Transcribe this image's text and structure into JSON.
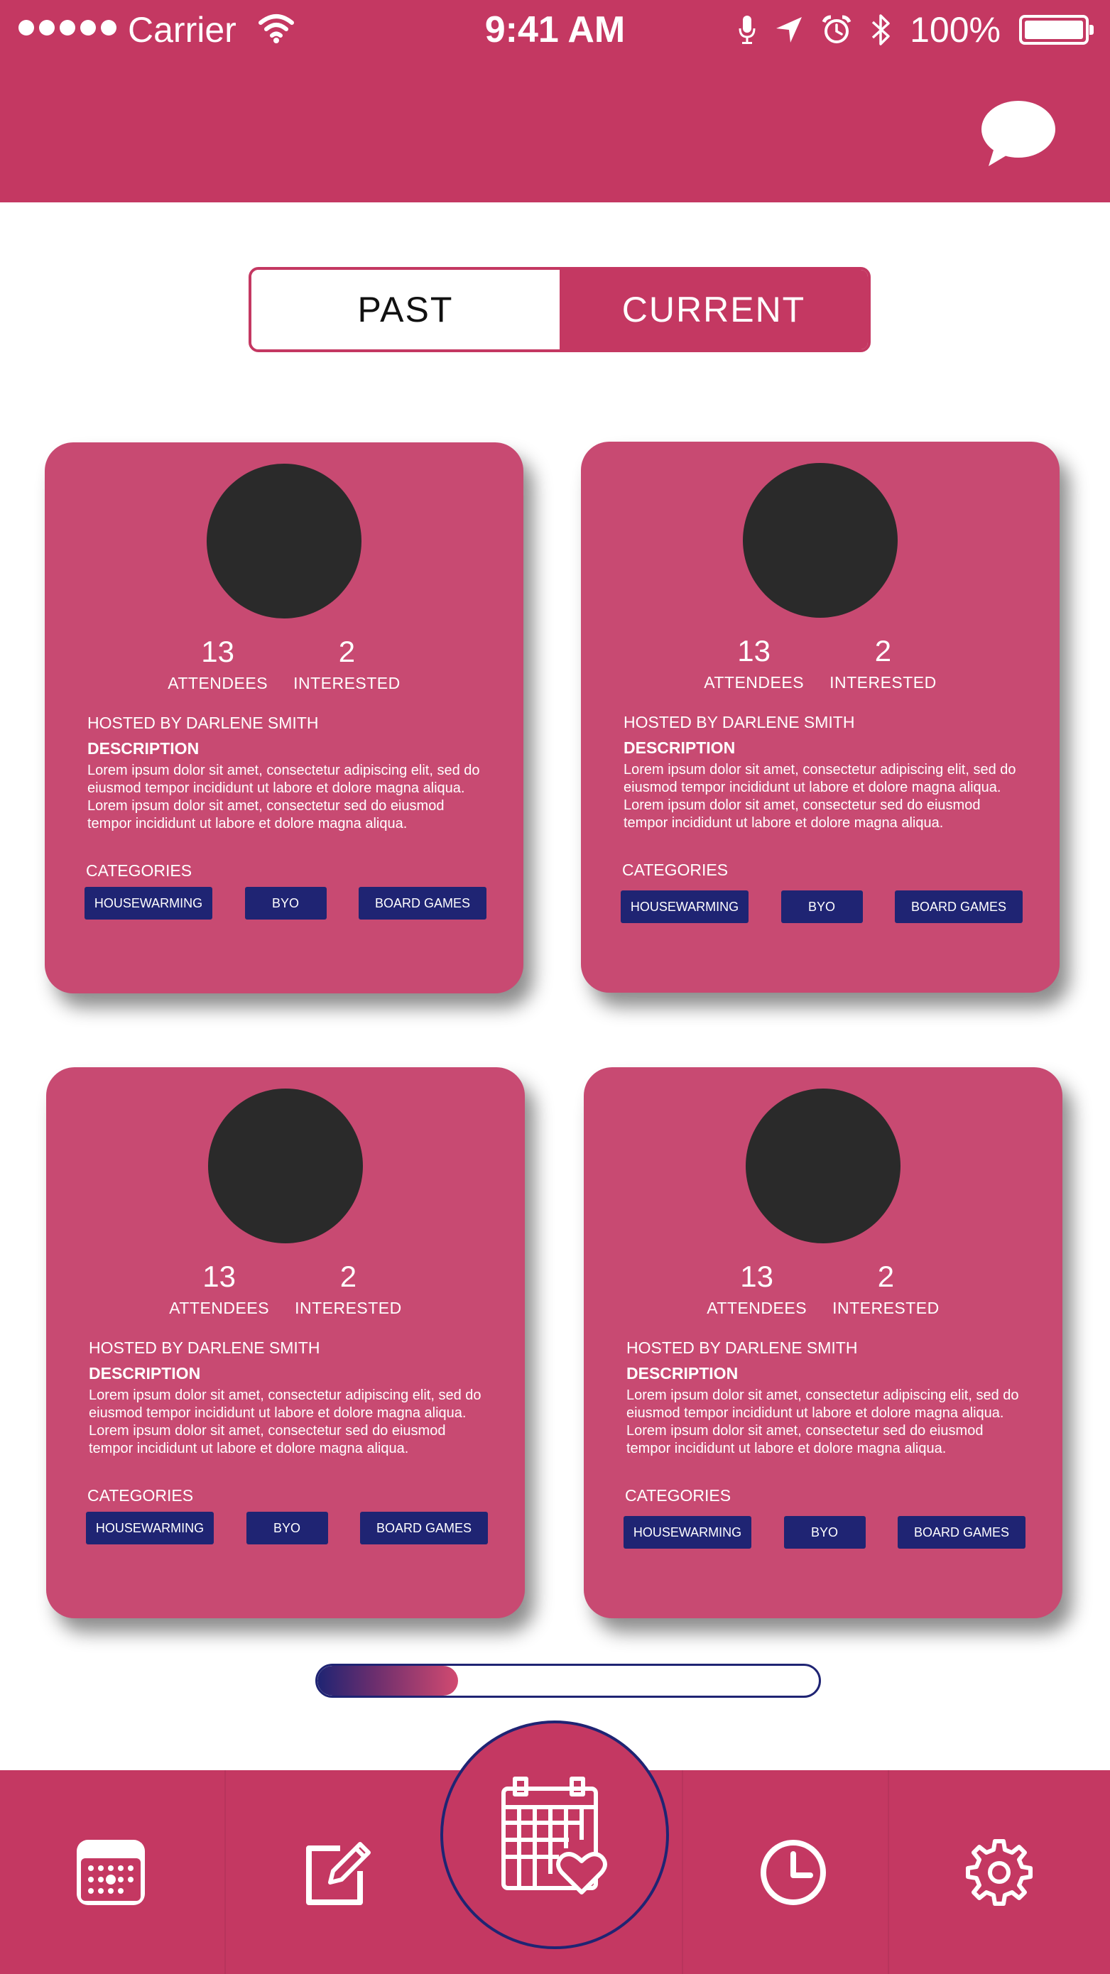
{
  "status_bar": {
    "carrier": "Carrier",
    "time": "9:41 AM",
    "battery_percent": "100%"
  },
  "header": {
    "chat_icon": "chat-bubble-icon"
  },
  "toggle": {
    "past_label": "PAST",
    "current_label": "CURRENT",
    "selected": "CURRENT"
  },
  "events": [
    {
      "attendees": "13",
      "attendees_label": "ATTENDEES",
      "interested": "2",
      "interested_label": "INTERESTED",
      "hosted_by": "HOSTED BY DARLENE SMITH",
      "description_label": "DESCRIPTION",
      "description": "Lorem ipsum dolor sit amet, consectetur adipiscing elit, sed do eiusmod tempor incididunt ut labore et dolore magna aliqua. Lorem ipsum dolor sit amet, consectetur sed do eiusmod tempor incididunt ut labore et dolore magna aliqua.",
      "categories_label": "CATEGORIES",
      "tags": [
        "HOUSEWARMING",
        "BYO",
        "BOARD GAMES"
      ]
    },
    {
      "attendees": "13",
      "attendees_label": "ATTENDEES",
      "interested": "2",
      "interested_label": "INTERESTED",
      "hosted_by": "HOSTED BY DARLENE SMITH",
      "description_label": "DESCRIPTION",
      "description": "Lorem ipsum dolor sit amet, consectetur adipiscing elit, sed do eiusmod tempor incididunt ut labore et dolore magna aliqua. Lorem ipsum dolor sit amet, consectetur sed do eiusmod tempor incididunt ut labore et dolore magna aliqua.",
      "categories_label": "CATEGORIES",
      "tags": [
        "HOUSEWARMING",
        "BYO",
        "BOARD GAMES"
      ]
    },
    {
      "attendees": "13",
      "attendees_label": "ATTENDEES",
      "interested": "2",
      "interested_label": "INTERESTED",
      "hosted_by": "HOSTED BY DARLENE SMITH",
      "description_label": "DESCRIPTION",
      "description": "Lorem ipsum dolor sit amet, consectetur adipiscing elit, sed do eiusmod tempor incididunt ut labore et dolore magna aliqua. Lorem ipsum dolor sit amet, consectetur sed do eiusmod tempor incididunt ut labore et dolore magna aliqua.",
      "categories_label": "CATEGORIES",
      "tags": [
        "HOUSEWARMING",
        "BYO",
        "BOARD GAMES"
      ]
    },
    {
      "attendees": "13",
      "attendees_label": "ATTENDEES",
      "interested": "2",
      "interested_label": "INTERESTED",
      "hosted_by": "HOSTED BY DARLENE SMITH",
      "description_label": "DESCRIPTION",
      "description": "Lorem ipsum dolor sit amet, consectetur adipiscing elit, sed do eiusmod tempor incididunt ut labore et dolore magna aliqua. Lorem ipsum dolor sit amet, consectetur sed do eiusmod tempor incididunt ut labore et dolore magna aliqua.",
      "categories_label": "CATEGORIES",
      "tags": [
        "HOUSEWARMING",
        "BYO",
        "BOARD GAMES"
      ]
    }
  ],
  "progress": {
    "fraction": 0.28
  },
  "tab_bar": {
    "tabs": [
      "calendar-icon",
      "edit-note-icon",
      "calendar-heart-icon",
      "clock-icon",
      "settings-gear-icon"
    ],
    "active": "calendar-heart-icon"
  },
  "colors": {
    "primary": "#c43862",
    "card": "#c84a72",
    "accent": "#1f2473",
    "avatar": "#2a2a2a"
  }
}
